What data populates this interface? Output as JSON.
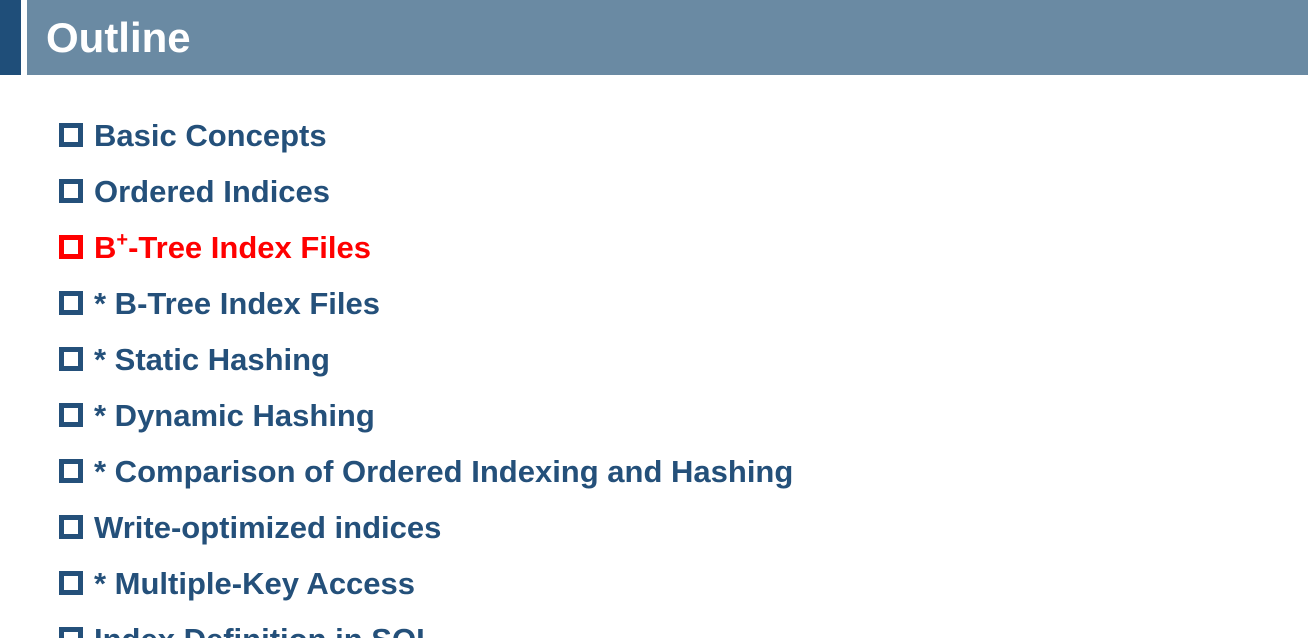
{
  "header": {
    "title": "Outline"
  },
  "outline": {
    "items": [
      {
        "label": "Basic Concepts",
        "current": false
      },
      {
        "label": "Ordered Indices",
        "current": false
      },
      {
        "label_prefix": "B",
        "label_sup": "+",
        "label_suffix": "-Tree Index Files",
        "current": true
      },
      {
        "label": "* B-Tree Index Files",
        "current": false
      },
      {
        "label": "* Static Hashing",
        "current": false
      },
      {
        "label": "* Dynamic Hashing",
        "current": false
      },
      {
        "label": "* Comparison of Ordered Indexing and Hashing",
        "current": false
      },
      {
        "label": "Write-optimized indices",
        "current": false
      },
      {
        "label": "* Multiple-Key Access",
        "current": false
      },
      {
        "label": "Index Definition in SQL",
        "current": false
      }
    ]
  },
  "colors": {
    "title_bar": "#6a8aa3",
    "accent_bar": "#1f4e79",
    "text": "#24507a",
    "current": "#ff0000"
  }
}
